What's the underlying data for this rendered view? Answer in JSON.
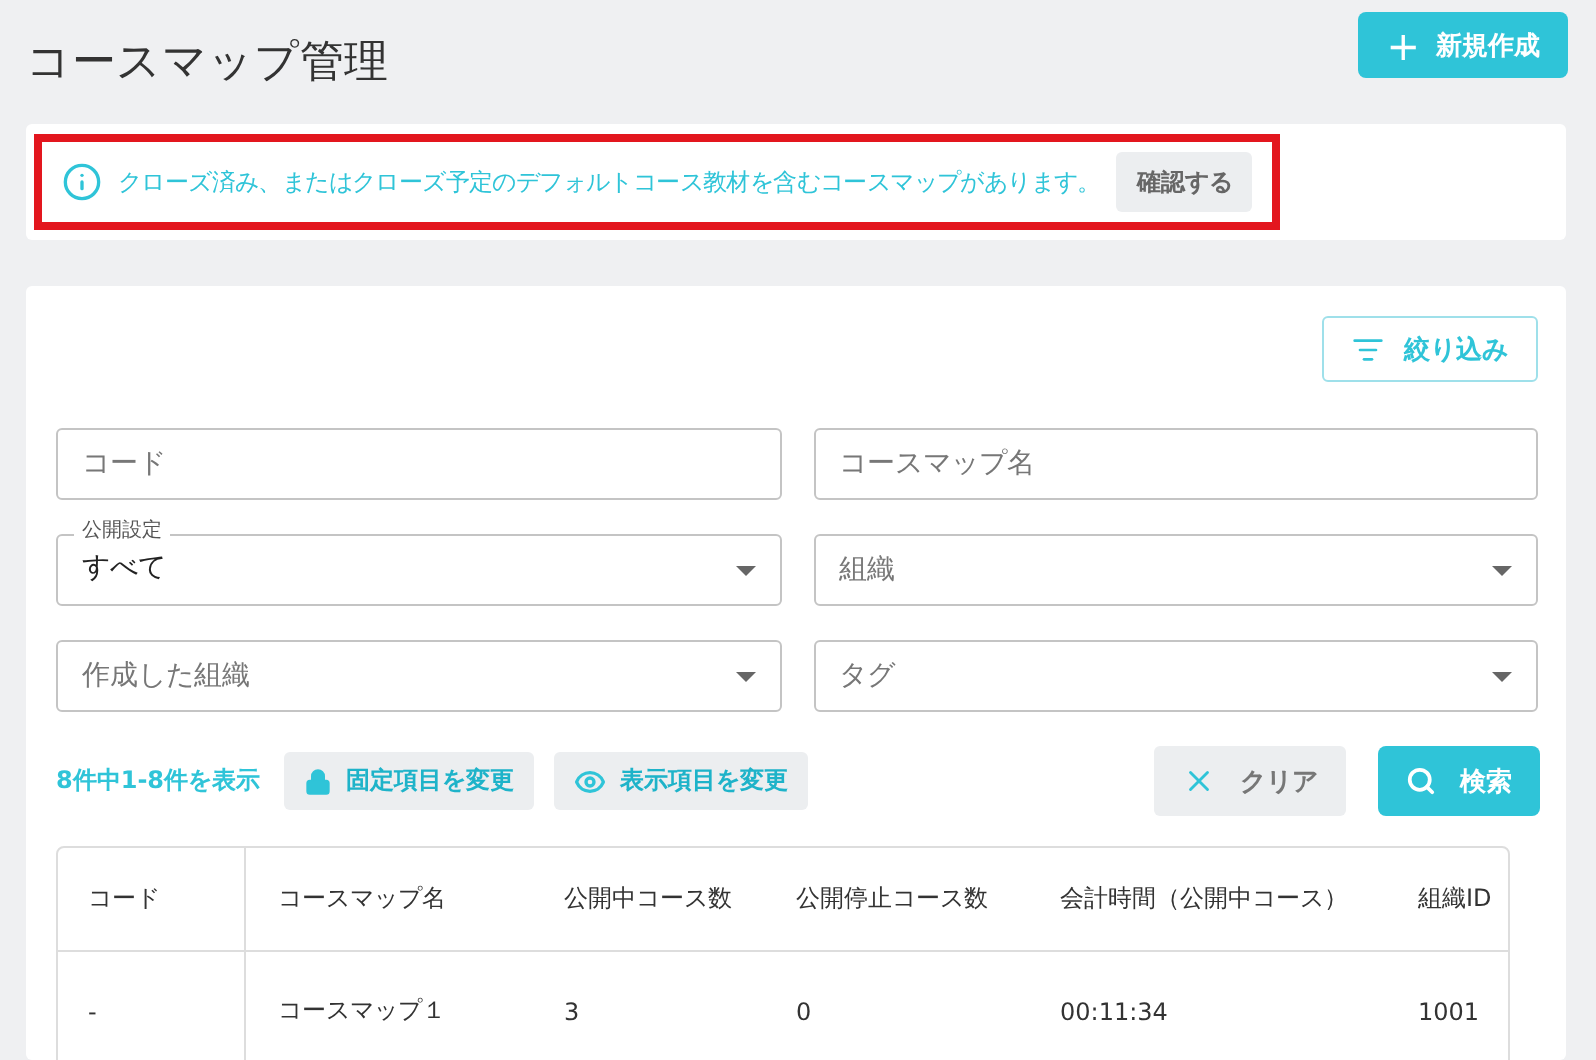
{
  "page": {
    "title": "コースマップ管理",
    "create_button": {
      "icon": "+",
      "label": "新規作成"
    }
  },
  "notice": {
    "text": "クローズ済み、またはクローズ予定のデフォルトコース教材を含むコースマップがあります。",
    "action": "確認する",
    "highlighted": true
  },
  "filter_button": "絞り込み",
  "fields": [
    {
      "kind": "text",
      "placeholder": "コード"
    },
    {
      "kind": "text",
      "placeholder": "コースマップ名"
    },
    {
      "kind": "select",
      "label": "公開設定",
      "value": "すべて"
    },
    {
      "kind": "select",
      "placeholder": "組織"
    },
    {
      "kind": "select",
      "placeholder": "作成した組織"
    },
    {
      "kind": "select",
      "placeholder": "タグ"
    }
  ],
  "result_count": "8件中1-8件を表示",
  "toolbar": [
    {
      "kind": "lock",
      "label": "固定項目を変更"
    },
    {
      "kind": "eye",
      "label": "表示項目を変更"
    }
  ],
  "clear_button": "クリア",
  "search_button": "検索",
  "table": {
    "columns": [
      "コード",
      "コースマップ名",
      "公開中コース数",
      "公開停止コース数",
      "会計時間（公開中コース）",
      "組織ID"
    ],
    "rows": [
      [
        "-",
        "コースマップ１",
        "3",
        "0",
        "00:11:34",
        "1001"
      ]
    ]
  }
}
